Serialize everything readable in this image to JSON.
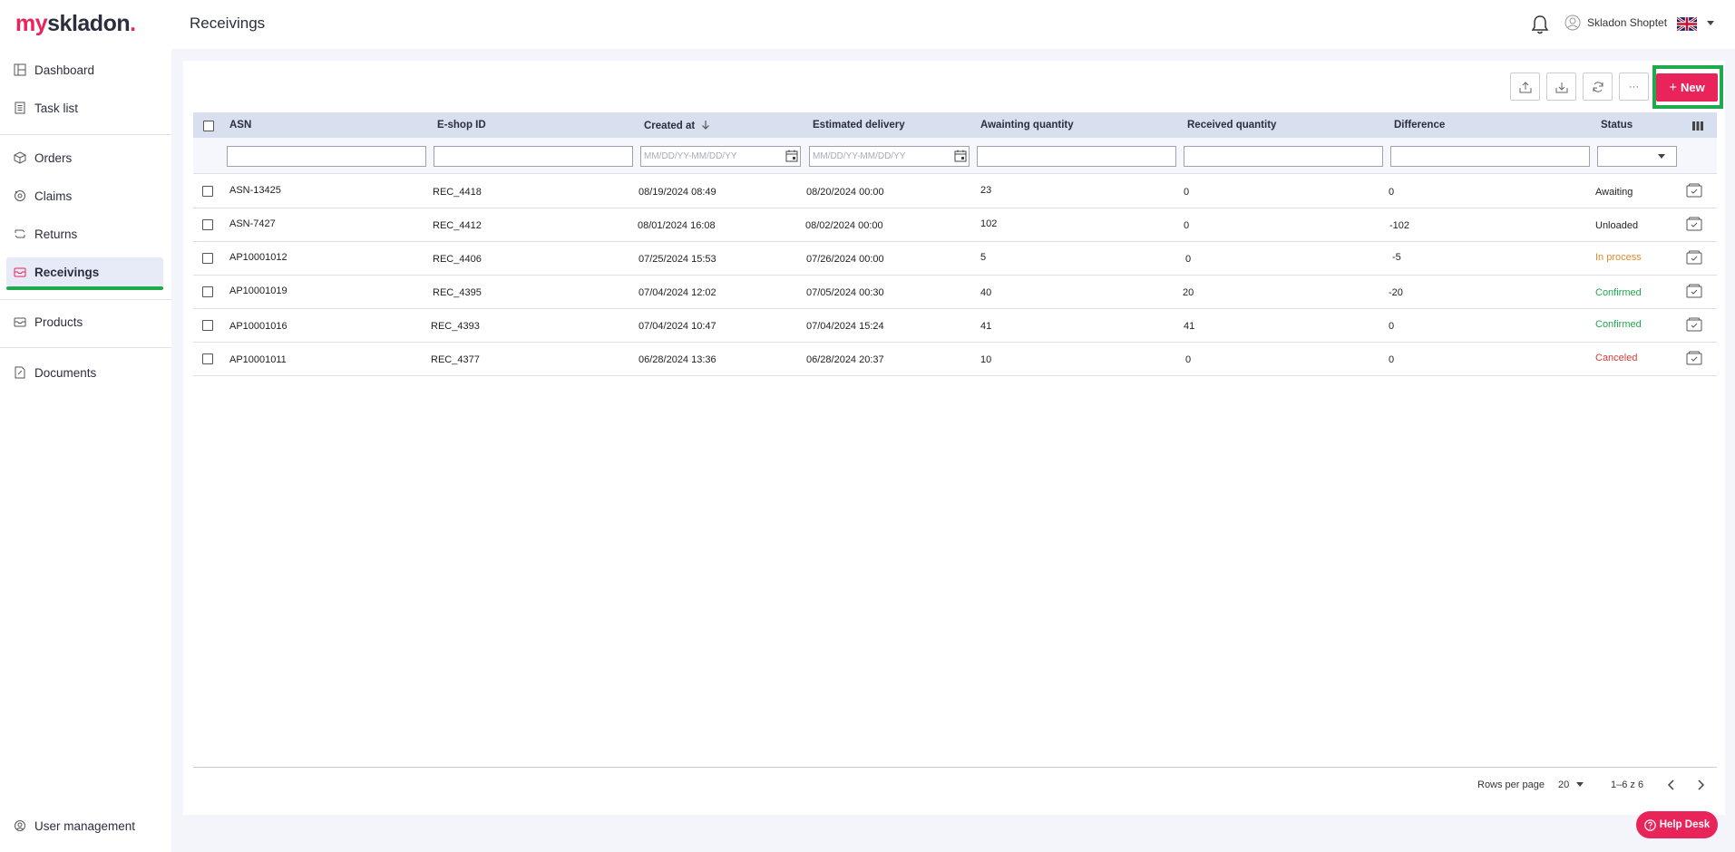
{
  "brand": {
    "logo_my": "my",
    "logo_rest": "skladon",
    "logo_dot": ".",
    "accent": "#e8245a",
    "active_indicator": "#1faa4d"
  },
  "header": {
    "title": "Receivings",
    "user_name": "Skladon Shoptet",
    "language_flag": "uk-flag-icon"
  },
  "sidebar": {
    "items": [
      {
        "label": "Dashboard",
        "icon": "dashboard-icon"
      },
      {
        "label": "Task list",
        "icon": "task-list-icon"
      },
      {
        "label": "Orders",
        "icon": "box-icon"
      },
      {
        "label": "Claims",
        "icon": "claims-icon"
      },
      {
        "label": "Returns",
        "icon": "returns-icon"
      },
      {
        "label": "Receivings",
        "icon": "receivings-icon"
      },
      {
        "label": "Products",
        "icon": "products-icon"
      },
      {
        "label": "Documents",
        "icon": "documents-icon"
      }
    ],
    "active": "Receivings",
    "footer_item": {
      "label": "User management",
      "icon": "user-management-icon"
    }
  },
  "toolbar": {
    "new_label": "New",
    "new_plus": "+",
    "more_label": "···"
  },
  "table": {
    "columns": [
      "ASN",
      "E-shop ID",
      "Created at",
      "Estimated delivery",
      "Awainting quantity",
      "Received quantity",
      "Difference",
      "Status"
    ],
    "sort_column": "Created at",
    "filters": {
      "created_at_placeholder": "MM/DD/YY-MM/DD/YY",
      "estimated_delivery_placeholder": "MM/DD/YY-MM/DD/YY"
    },
    "rows": [
      {
        "asn": "ASN-13425",
        "eshop_id": "REC_4418",
        "created_at": "08/19/2024 08:49",
        "estimated_delivery": "08/20/2024 00:00",
        "awaiting": "23",
        "received": "0",
        "difference": "0",
        "status": "Awaiting"
      },
      {
        "asn": "ASN-7427",
        "eshop_id": "REC_4412",
        "created_at": "08/01/2024 16:08",
        "estimated_delivery": "08/02/2024 00:00",
        "awaiting": "102",
        "received": "0",
        "difference": "-102",
        "status": "Unloaded"
      },
      {
        "asn": "AP10001012",
        "eshop_id": "REC_4406",
        "created_at": "07/25/2024 15:53",
        "estimated_delivery": "07/26/2024 00:00",
        "awaiting": "5",
        "received": "0",
        "difference": "-5",
        "status": "In process"
      },
      {
        "asn": "AP10001019",
        "eshop_id": "REC_4395",
        "created_at": "07/04/2024 12:02",
        "estimated_delivery": "07/05/2024 00:30",
        "awaiting": "40",
        "received": "20",
        "difference": "-20",
        "status": "Confirmed"
      },
      {
        "asn": "AP10001016",
        "eshop_id": "REC_4393",
        "created_at": "07/04/2024 10:47",
        "estimated_delivery": "07/04/2024 15:24",
        "awaiting": "41",
        "received": "41",
        "difference": "0",
        "status": "Confirmed"
      },
      {
        "asn": "AP10001011",
        "eshop_id": "REC_4377",
        "created_at": "06/28/2024 13:36",
        "estimated_delivery": "06/28/2024 20:37",
        "awaiting": "10",
        "received": "0",
        "difference": "0",
        "status": "Canceled"
      }
    ]
  },
  "pagination": {
    "rows_per_page_label": "Rows per page",
    "rows_per_page": "20",
    "range": "1–6 z 6"
  },
  "help": {
    "label": "Help Desk"
  }
}
